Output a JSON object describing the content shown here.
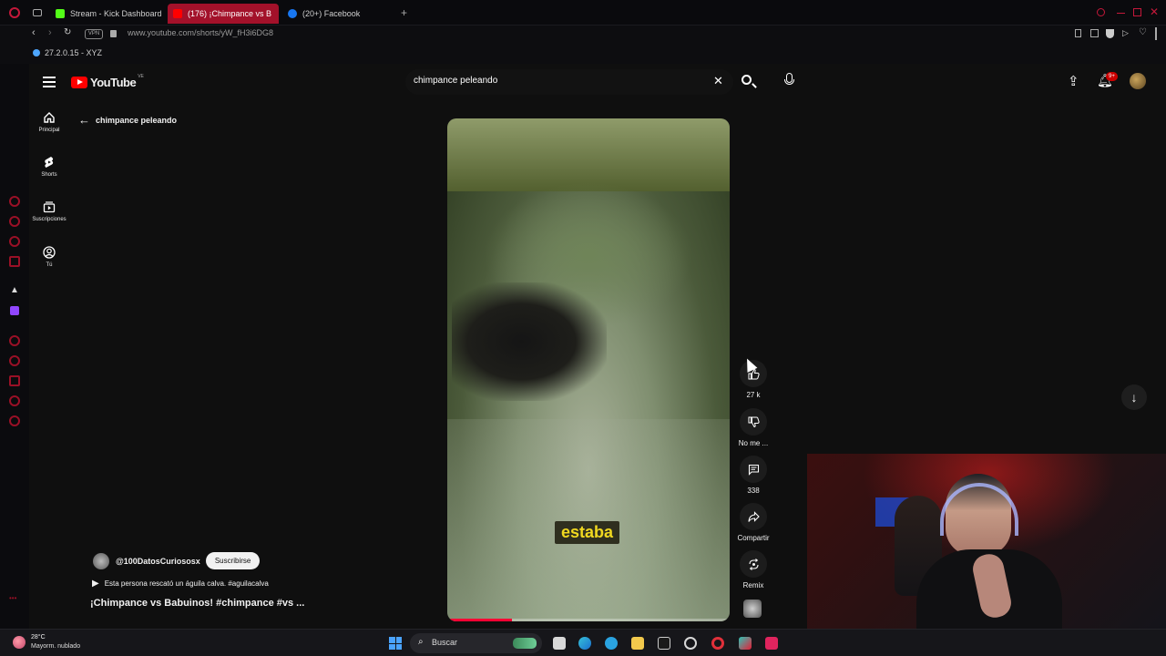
{
  "browser": {
    "tabs": [
      {
        "label": "Stream - Kick Dashboard",
        "active": false,
        "color": "#53fc18"
      },
      {
        "label": "(176) ¡Chimpance vs B",
        "active": true,
        "color": "#ff0000"
      },
      {
        "label": "(20+) Facebook",
        "active": false,
        "color": "#1877f2"
      }
    ],
    "vpn_label": "VPN",
    "url": "www.youtube.com/shorts/yW_fH3i6DG8",
    "bookmark": "27.2.0.15 - XYZ"
  },
  "youtube": {
    "logo_text": "YouTube",
    "logo_region": "VE",
    "search_value": "chimpance peleando",
    "notif_count": "9+",
    "back_label": "chimpance peleando",
    "nav": [
      {
        "label": "Principal",
        "icon": "home-icon"
      },
      {
        "label": "Shorts",
        "icon": "shorts-icon"
      },
      {
        "label": "Suscripciones",
        "icon": "subscriptions-icon"
      },
      {
        "label": "Tú",
        "icon": "you-icon"
      }
    ],
    "short": {
      "caption": "estaba",
      "channel": "@100DatosCuriososx",
      "subscribe": "Suscribirse",
      "linked_video": "Esta persona rescató un águila calva. #aguilacalva",
      "title": "¡Chimpance vs Babuinos! #chimpance #vs ...",
      "progress_fraction": 0.23
    },
    "actions": [
      {
        "icon": "like-icon",
        "label": "27 k"
      },
      {
        "icon": "dislike-icon",
        "label": "No me ..."
      },
      {
        "icon": "comment-icon",
        "label": "338"
      },
      {
        "icon": "share-icon",
        "label": "Compartir"
      },
      {
        "icon": "remix-icon",
        "label": "Remix"
      }
    ]
  },
  "taskbar": {
    "temp": "28°C",
    "weather": "Mayorm. nublado",
    "search_label": "Buscar"
  }
}
